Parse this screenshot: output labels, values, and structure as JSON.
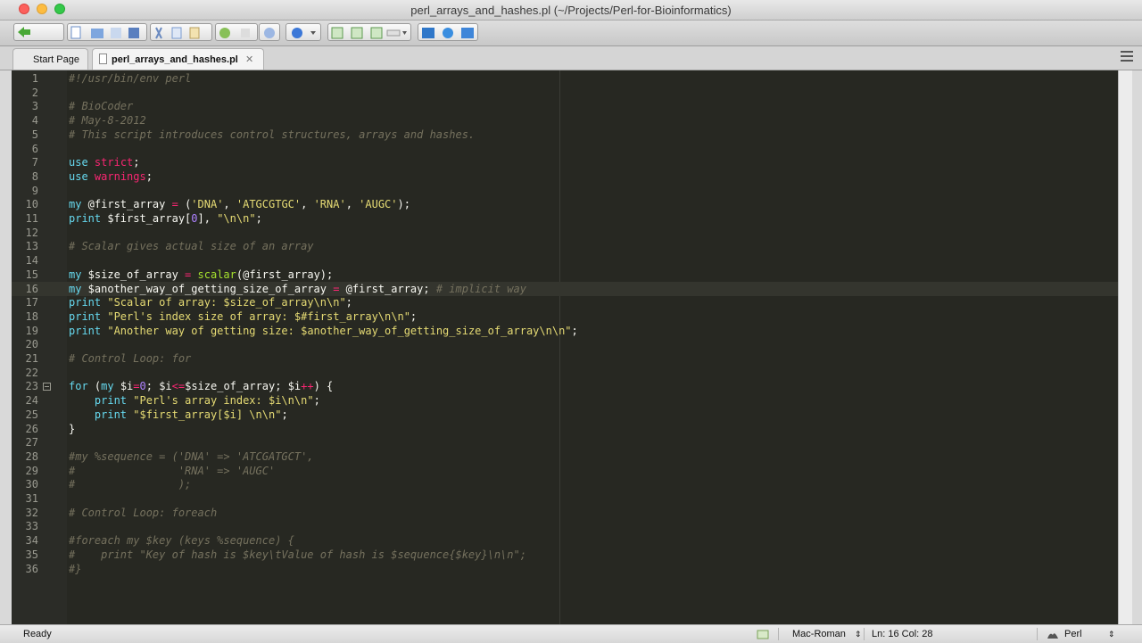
{
  "window": {
    "title": "perl_arrays_and_hashes.pl (~/Projects/Perl-for-Bioinformatics)"
  },
  "tabs": [
    {
      "label": "Start Page"
    },
    {
      "label": "perl_arrays_and_hashes.pl"
    }
  ],
  "editor": {
    "current_line": 16,
    "lines": [
      {
        "n": "1",
        "text": "#!/usr/bin/env perl"
      },
      {
        "n": "2",
        "text": ""
      },
      {
        "n": "3",
        "text": "# BioCoder"
      },
      {
        "n": "4",
        "text": "# May-8-2012"
      },
      {
        "n": "5",
        "text": "# This script introduces control structures, arrays and hashes."
      },
      {
        "n": "6",
        "text": ""
      },
      {
        "n": "7",
        "text": "use strict;"
      },
      {
        "n": "8",
        "text": "use warnings;"
      },
      {
        "n": "9",
        "text": ""
      },
      {
        "n": "10",
        "text": "my @first_array = ('DNA', 'ATGCGTGC', 'RNA', 'AUGC');"
      },
      {
        "n": "11",
        "text": "print $first_array[0], \"\\n\\n\";"
      },
      {
        "n": "12",
        "text": ""
      },
      {
        "n": "13",
        "text": "# Scalar gives actual size of an array"
      },
      {
        "n": "14",
        "text": ""
      },
      {
        "n": "15",
        "text": "my $size_of_array = scalar(@first_array);"
      },
      {
        "n": "16",
        "text": "my $another_way_of_getting_size_of_array = @first_array; # implicit way"
      },
      {
        "n": "17",
        "text": "print \"Scalar of array: $size_of_array\\n\\n\";"
      },
      {
        "n": "18",
        "text": "print \"Perl's index size of array: $#first_array\\n\\n\";"
      },
      {
        "n": "19",
        "text": "print \"Another way of getting size: $another_way_of_getting_size_of_array\\n\\n\";"
      },
      {
        "n": "20",
        "text": ""
      },
      {
        "n": "21",
        "text": "# Control Loop: for"
      },
      {
        "n": "22",
        "text": ""
      },
      {
        "n": "23",
        "text": "for (my $i=0; $i<=$size_of_array; $i++) {"
      },
      {
        "n": "24",
        "text": "    print \"Perl's array index: $i\\n\\n\";"
      },
      {
        "n": "25",
        "text": "    print \"$first_array[$i] \\n\\n\";"
      },
      {
        "n": "26",
        "text": "}"
      },
      {
        "n": "27",
        "text": ""
      },
      {
        "n": "28",
        "text": "#my %sequence = ('DNA' => 'ATCGATGCT',"
      },
      {
        "n": "29",
        "text": "#                'RNA' => 'AUGC'"
      },
      {
        "n": "30",
        "text": "#                );"
      },
      {
        "n": "31",
        "text": ""
      },
      {
        "n": "32",
        "text": "# Control Loop: foreach"
      },
      {
        "n": "33",
        "text": ""
      },
      {
        "n": "34",
        "text": "#foreach my $key (keys %sequence) {"
      },
      {
        "n": "35",
        "text": "#    print \"Key of hash is $key\\tValue of hash is $sequence{$key}\\n\\n\";"
      },
      {
        "n": "36",
        "text": "#}"
      }
    ]
  },
  "status": {
    "state": "Ready",
    "encoding": "Mac-Roman",
    "position": "Ln: 16 Col: 28",
    "language": "Perl"
  },
  "colors": {
    "editor_bg": "#272822",
    "comment": "#75715e",
    "string": "#e6db74",
    "keyword": "#f92672"
  }
}
